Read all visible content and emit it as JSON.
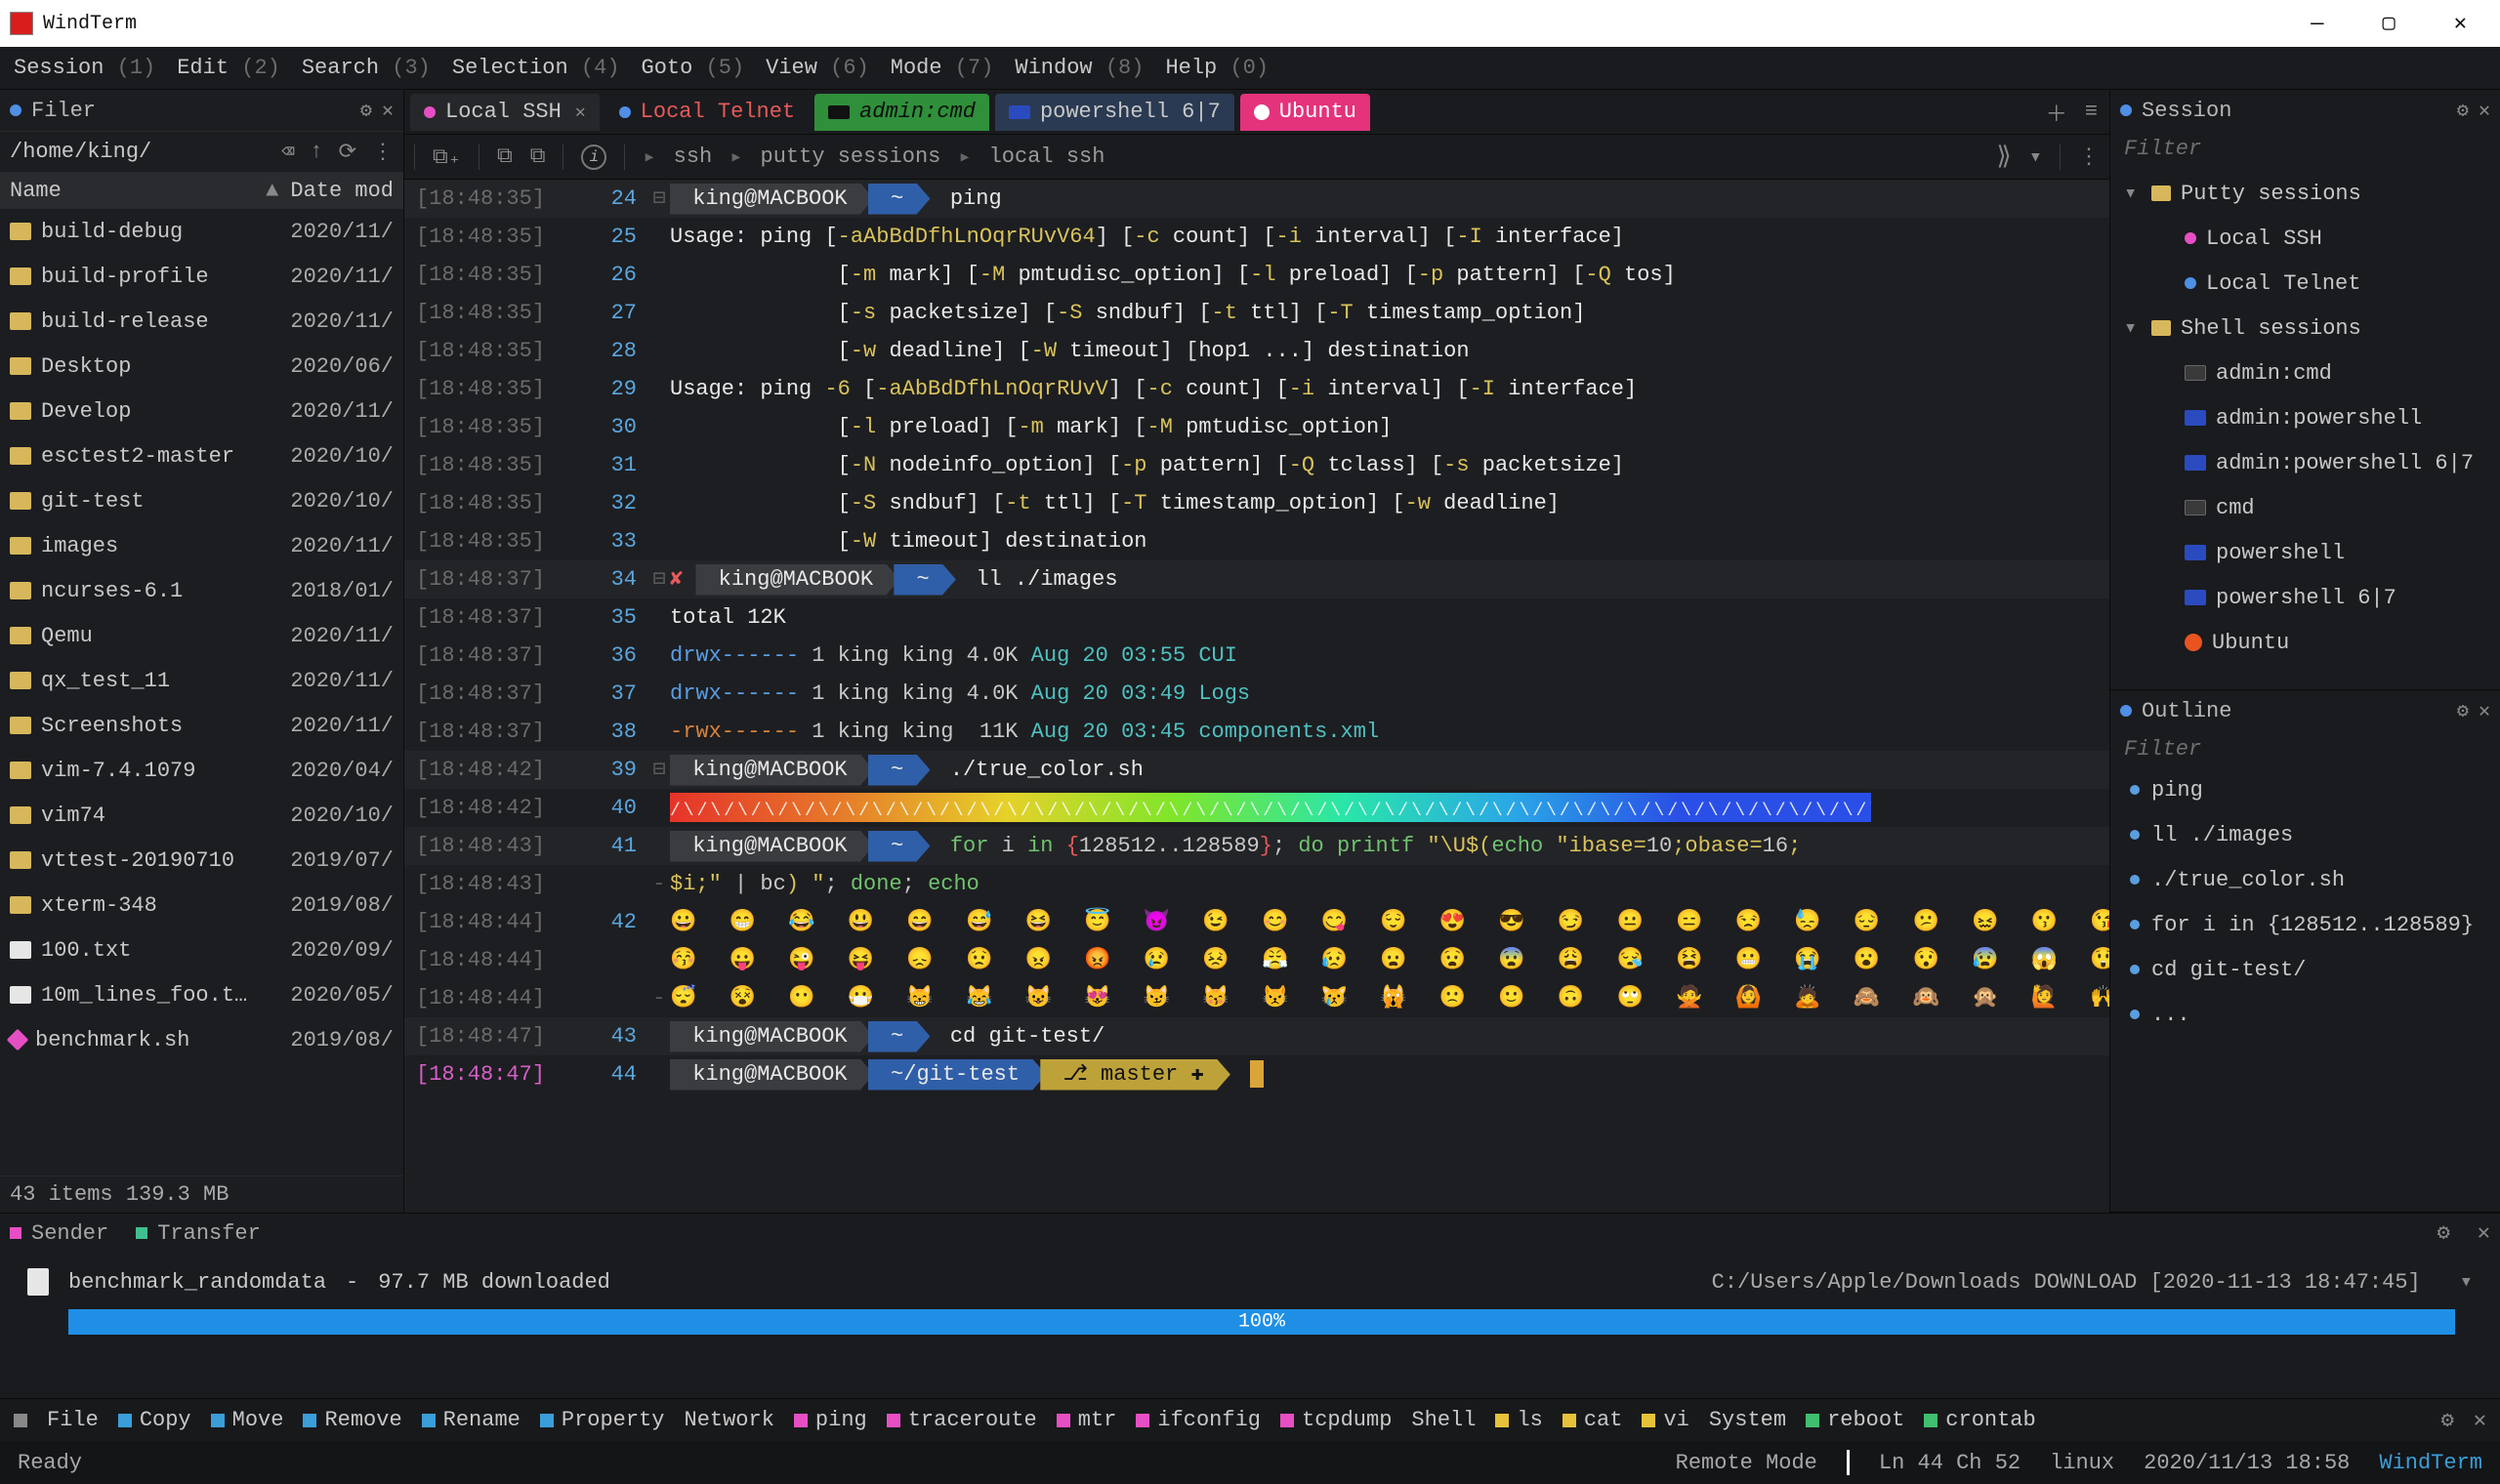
{
  "window": {
    "title": "WindTerm"
  },
  "menu": [
    {
      "label": "Session",
      "key": "(1)"
    },
    {
      "label": "Edit",
      "key": "(2)"
    },
    {
      "label": "Search",
      "key": "(3)"
    },
    {
      "label": "Selection",
      "key": "(4)"
    },
    {
      "label": "Goto",
      "key": "(5)"
    },
    {
      "label": "View",
      "key": "(6)"
    },
    {
      "label": "Mode",
      "key": "(7)"
    },
    {
      "label": "Window",
      "key": "(8)"
    },
    {
      "label": "Help",
      "key": "(0)"
    }
  ],
  "filer": {
    "title": "Filer",
    "path": "/home/king/",
    "columns": {
      "name": "Name",
      "date": "Date mod"
    },
    "items": [
      {
        "name": "build-debug",
        "date": "2020/11/",
        "type": "folder"
      },
      {
        "name": "build-profile",
        "date": "2020/11/",
        "type": "folder"
      },
      {
        "name": "build-release",
        "date": "2020/11/",
        "type": "folder"
      },
      {
        "name": "Desktop",
        "date": "2020/06/",
        "type": "folder"
      },
      {
        "name": "Develop",
        "date": "2020/11/",
        "type": "folder"
      },
      {
        "name": "esctest2-master",
        "date": "2020/10/",
        "type": "folder"
      },
      {
        "name": "git-test",
        "date": "2020/10/",
        "type": "folder"
      },
      {
        "name": "images",
        "date": "2020/11/",
        "type": "folder"
      },
      {
        "name": "ncurses-6.1",
        "date": "2018/01/",
        "type": "folder"
      },
      {
        "name": "Qemu",
        "date": "2020/11/",
        "type": "folder"
      },
      {
        "name": "qx_test_11",
        "date": "2020/11/",
        "type": "folder"
      },
      {
        "name": "Screenshots",
        "date": "2020/11/",
        "type": "folder"
      },
      {
        "name": "vim-7.4.1079",
        "date": "2020/04/",
        "type": "folder"
      },
      {
        "name": "vim74",
        "date": "2020/10/",
        "type": "folder"
      },
      {
        "name": "vttest-20190710",
        "date": "2019/07/",
        "type": "folder"
      },
      {
        "name": "xterm-348",
        "date": "2019/08/",
        "type": "folder"
      },
      {
        "name": "100.txt",
        "date": "2020/09/",
        "type": "file"
      },
      {
        "name": "10m_lines_foo.t…",
        "date": "2020/05/",
        "type": "file"
      },
      {
        "name": "benchmark.sh",
        "date": "2019/08/",
        "type": "script"
      }
    ],
    "status": "43 items 139.3 MB"
  },
  "tabs": {
    "items": [
      {
        "id": "local-ssh",
        "label": "Local SSH",
        "color": "#e64fc3",
        "active": true,
        "closable": true,
        "style": "plain"
      },
      {
        "id": "local-telnet",
        "label": "Local Telnet",
        "color": "#4f8fe6",
        "style": "telnet"
      },
      {
        "id": "admin-cmd",
        "label": "admin:cmd",
        "style": "admincmd"
      },
      {
        "id": "powershell67",
        "label": "powershell 6|7",
        "style": "powershell"
      },
      {
        "id": "ubuntu",
        "label": "Ubuntu",
        "style": "ubuntu"
      }
    ]
  },
  "breadcrumb": {
    "a": "ssh",
    "b": "putty sessions",
    "c": "local ssh"
  },
  "terminal": {
    "prompt_user": "king@MACBOOK",
    "tilde": "~",
    "lines": [
      {
        "ts": "[18:48:35]",
        "ln": "24",
        "fold": "⊟",
        "type": "prompt",
        "cmd": "ping"
      },
      {
        "ts": "[18:48:35]",
        "ln": "25",
        "type": "text",
        "html": "<span class='c-white'>Usage: ping </span><span class='c-white'>[</span><span class='c-yellow'>-aAbBdDfhLnOqrRUvV64</span><span class='c-white'>] [</span><span class='c-yellow'>-c</span><span class='c-white'> count] [</span><span class='c-yellow'>-i</span><span class='c-white'> interval] [</span><span class='c-yellow'>-I</span><span class='c-white'> interface]</span>"
      },
      {
        "ts": "[18:48:35]",
        "ln": "26",
        "type": "text",
        "html": "             <span class='c-white'>[</span><span class='c-yellow'>-m</span><span class='c-white'> mark] [</span><span class='c-yellow'>-M</span><span class='c-white'> pmtudisc_option] [</span><span class='c-yellow'>-l</span><span class='c-white'> preload] [</span><span class='c-yellow'>-p</span><span class='c-white'> pattern] [</span><span class='c-yellow'>-Q</span><span class='c-white'> tos]</span>"
      },
      {
        "ts": "[18:48:35]",
        "ln": "27",
        "type": "text",
        "html": "             <span class='c-white'>[</span><span class='c-yellow'>-s</span><span class='c-white'> packetsize] [</span><span class='c-yellow'>-S</span><span class='c-white'> sndbuf] [</span><span class='c-yellow'>-t</span><span class='c-white'> ttl] [</span><span class='c-yellow'>-T</span><span class='c-white'> timestamp_option]</span>"
      },
      {
        "ts": "[18:48:35]",
        "ln": "28",
        "type": "text",
        "html": "             <span class='c-white'>[</span><span class='c-yellow'>-w</span><span class='c-white'> deadline] [</span><span class='c-yellow'>-W</span><span class='c-white'> timeout] [hop1 ...] destination</span>"
      },
      {
        "ts": "[18:48:35]",
        "ln": "29",
        "type": "text",
        "html": "<span class='c-white'>Usage: ping </span><span class='c-yellow'>-6</span><span class='c-white'> [</span><span class='c-yellow'>-aAbBdDfhLnOqrRUvV</span><span class='c-white'>] [</span><span class='c-yellow'>-c</span><span class='c-white'> count] [</span><span class='c-yellow'>-i</span><span class='c-white'> interval] [</span><span class='c-yellow'>-I</span><span class='c-white'> interface]</span>"
      },
      {
        "ts": "[18:48:35]",
        "ln": "30",
        "type": "text",
        "html": "             <span class='c-white'>[</span><span class='c-yellow'>-l</span><span class='c-white'> preload] [</span><span class='c-yellow'>-m</span><span class='c-white'> mark] [</span><span class='c-yellow'>-M</span><span class='c-white'> pmtudisc_option]</span>"
      },
      {
        "ts": "[18:48:35]",
        "ln": "31",
        "type": "text",
        "html": "             <span class='c-white'>[</span><span class='c-yellow'>-N</span><span class='c-white'> nodeinfo_option] [</span><span class='c-yellow'>-p</span><span class='c-white'> pattern] [</span><span class='c-yellow'>-Q</span><span class='c-white'> tclass] [</span><span class='c-yellow'>-s</span><span class='c-white'> packetsize]</span>"
      },
      {
        "ts": "[18:48:35]",
        "ln": "32",
        "type": "text",
        "html": "             <span class='c-white'>[</span><span class='c-yellow'>-S</span><span class='c-white'> sndbuf] [</span><span class='c-yellow'>-t</span><span class='c-white'> ttl] [</span><span class='c-yellow'>-T</span><span class='c-white'> timestamp_option] [</span><span class='c-yellow'>-w</span><span class='c-white'> deadline]</span>"
      },
      {
        "ts": "[18:48:35]",
        "ln": "33",
        "type": "text",
        "html": "             <span class='c-white'>[</span><span class='c-yellow'>-W</span><span class='c-white'> timeout] destination</span>"
      },
      {
        "ts": "[18:48:37]",
        "ln": "34",
        "fold": "⊟",
        "type": "prompt-x",
        "cmd": "ll ./images"
      },
      {
        "ts": "[18:48:37]",
        "ln": "35",
        "type": "text",
        "html": "<span class='c-white'>total 12K</span>"
      },
      {
        "ts": "[18:48:37]",
        "ln": "36",
        "type": "text",
        "html": "<span class='c-blue'>drwx------</span> 1 king king 4.0K <span class='c-teal'>Aug 20 03:55</span> <span class='c-teal'>CUI</span>"
      },
      {
        "ts": "[18:48:37]",
        "ln": "37",
        "type": "text",
        "html": "<span class='c-blue'>drwx------</span> 1 king king 4.0K <span class='c-teal'>Aug 20 03:49</span> <span class='c-teal'>Logs</span>"
      },
      {
        "ts": "[18:48:37]",
        "ln": "38",
        "type": "text",
        "html": "<span class='c-orange'>-rwx------</span> 1 king king  11K <span class='c-teal'>Aug 20 03:45</span> <span class='c-teal'>components.xml</span>"
      },
      {
        "ts": "[18:48:42]",
        "ln": "39",
        "fold": "⊟",
        "type": "prompt",
        "cmd": "./true_color.sh"
      },
      {
        "ts": "[18:48:42]",
        "ln": "40",
        "type": "gradient"
      },
      {
        "ts": "[18:48:43]",
        "ln": "41",
        "type": "prompt",
        "cmd_html": "<span class='c-green'>for</span> i <span class='c-green'>in</span> <span class='c-red'>{</span>128512..128589<span class='c-red'>}</span>; <span class='c-green'>do</span> <span class='c-green'>printf</span> <span class='c-yellow'>\"\\U$(</span><span class='c-green'>echo</span> <span class='c-yellow'>\"ibase=</span>10<span class='c-yellow'>;obase=</span>16<span class='c-yellow'>;</span>"
      },
      {
        "ts": "[18:48:43]",
        "ln": "",
        "gutter": "-",
        "type": "text",
        "html": "<span class='c-yellow'>$i;\"</span> | bc<span class='c-yellow'>) \"</span>; <span class='c-green'>done</span>; <span class='c-green'>echo</span>"
      },
      {
        "ts": "[18:48:44]",
        "ln": "42",
        "type": "emoji",
        "row": "😀 😁 😂 😃 😄 😅 😆 😇 😈 😉 😊 😋 😌 😍 😎 😏 😐 😑 😒 😓 😔 😕 😖 😗 😘 😙"
      },
      {
        "ts": "[18:48:44]",
        "ln": "",
        "type": "emoji",
        "row": "😚 😛 😜 😝 😞 😟 😠 😡 😢 😣 😤 😥 😦 😧 😨 😩 😪 😫 😬 😭 😮 😯 😰 😱 😲 😳"
      },
      {
        "ts": "[18:48:44]",
        "ln": "",
        "gutter": "-",
        "type": "emoji",
        "row": "😴 😵 😶 😷 😸 😹 😺 😻 😼 😽 😾 😿 🙀 🙁 🙂 🙃 🙄 🙅 🙆 🙇 🙈 🙉 🙊 🙋 🙌 🙍"
      },
      {
        "ts": "[18:48:47]",
        "ln": "43",
        "type": "prompt",
        "cmd": "cd git-test/"
      },
      {
        "ts": "[18:48:47]",
        "ln": "44",
        "active": true,
        "type": "prompt-git",
        "cwd": "~/git-test",
        "branch": "master"
      }
    ]
  },
  "session_panel": {
    "title": "Session",
    "filter_placeholder": "Filter",
    "groups": [
      {
        "name": "Putty sessions",
        "items": [
          {
            "label": "Local SSH",
            "icon": "dot",
            "color": "#e64fc3"
          },
          {
            "label": "Local Telnet",
            "icon": "dot",
            "color": "#4f8fe6"
          }
        ]
      },
      {
        "name": "Shell sessions",
        "items": [
          {
            "label": "admin:cmd",
            "icon": "cmd"
          },
          {
            "label": "admin:powershell",
            "icon": "ps"
          },
          {
            "label": "admin:powershell 6|7",
            "icon": "ps"
          },
          {
            "label": "cmd",
            "icon": "cmd"
          },
          {
            "label": "powershell",
            "icon": "ps"
          },
          {
            "label": "powershell 6|7",
            "icon": "ps"
          },
          {
            "label": "Ubuntu",
            "icon": "ub"
          }
        ]
      }
    ]
  },
  "outline": {
    "title": "Outline",
    "filter_placeholder": "Filter",
    "items": [
      "ping",
      "ll ./images",
      "./true_color.sh",
      "for i in {128512..128589}",
      "cd git-test/",
      "..."
    ]
  },
  "bottom_tabs": {
    "sender": "Sender",
    "transfer": "Transfer"
  },
  "transfer": {
    "filename": "benchmark_randomdata",
    "status": "97.7 MB downloaded",
    "dest": "C:/Users/Apple/Downloads DOWNLOAD [2020-11-13 18:47:45]",
    "progress_pct": "100%"
  },
  "action_bar": [
    {
      "label": "",
      "icon": "#888"
    },
    {
      "label": "File",
      "icon": ""
    },
    {
      "label": "Copy",
      "icon": "#3a9ed9"
    },
    {
      "label": "Move",
      "icon": "#3a9ed9"
    },
    {
      "label": "Remove",
      "icon": "#3a9ed9"
    },
    {
      "label": "Rename",
      "icon": "#3a9ed9"
    },
    {
      "label": "Property",
      "icon": "#3a9ed9"
    },
    {
      "label": "Network",
      "icon": ""
    },
    {
      "label": "ping",
      "icon": "#e64fc3"
    },
    {
      "label": "traceroute",
      "icon": "#e64fc3"
    },
    {
      "label": "mtr",
      "icon": "#e64fc3"
    },
    {
      "label": "ifconfig",
      "icon": "#e64fc3"
    },
    {
      "label": "tcpdump",
      "icon": "#e64fc3"
    },
    {
      "label": "Shell",
      "icon": ""
    },
    {
      "label": "ls",
      "icon": "#e6c23a"
    },
    {
      "label": "cat",
      "icon": "#e6c23a"
    },
    {
      "label": "vi",
      "icon": "#e6c23a"
    },
    {
      "label": "System",
      "icon": ""
    },
    {
      "label": "reboot",
      "icon": "#3fbf6f"
    },
    {
      "label": "crontab",
      "icon": "#3fbf6f"
    }
  ],
  "statusbar": {
    "ready": "Ready",
    "remote": "Remote Mode",
    "pos": "Ln 44 Ch 52",
    "os": "linux",
    "datetime": "2020/11/13 18:58",
    "brand": "WindTerm"
  }
}
